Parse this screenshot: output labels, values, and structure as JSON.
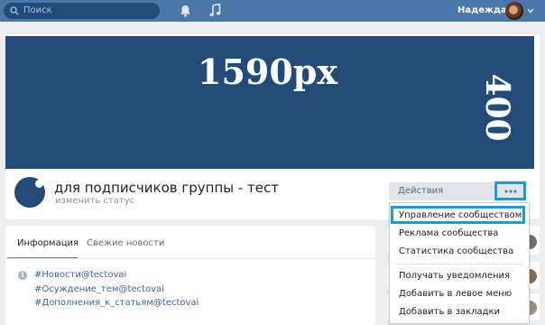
{
  "header": {
    "search_placeholder": "Поиск",
    "username": "Надежда",
    "icons": [
      "search-icon",
      "bell-icon",
      "music-icon",
      "chevron-down-icon"
    ],
    "bar_color": "#4a76a8"
  },
  "cover": {
    "width_label": "1590px",
    "height_label": "400",
    "color": "#224b7a"
  },
  "group": {
    "title": "для подписчиков группы - тест",
    "status": "изменить статус"
  },
  "actions": {
    "label": "Действия",
    "more_icon": "more-dots-icon",
    "menu": [
      "Управление сообществом",
      "Реклама сообщества",
      "Статистика сообщества",
      "Получать уведомления",
      "Добавить в левое меню",
      "Добавить в закладки"
    ],
    "highlight_color": "#1a9bdc"
  },
  "info": {
    "tabs": [
      "Информация",
      "Свежие новости"
    ],
    "tags": [
      "#Новости@tectovai",
      "#Осуждение_тем@tectovai",
      "#Дополнения_к_статьям@tectovai"
    ]
  }
}
